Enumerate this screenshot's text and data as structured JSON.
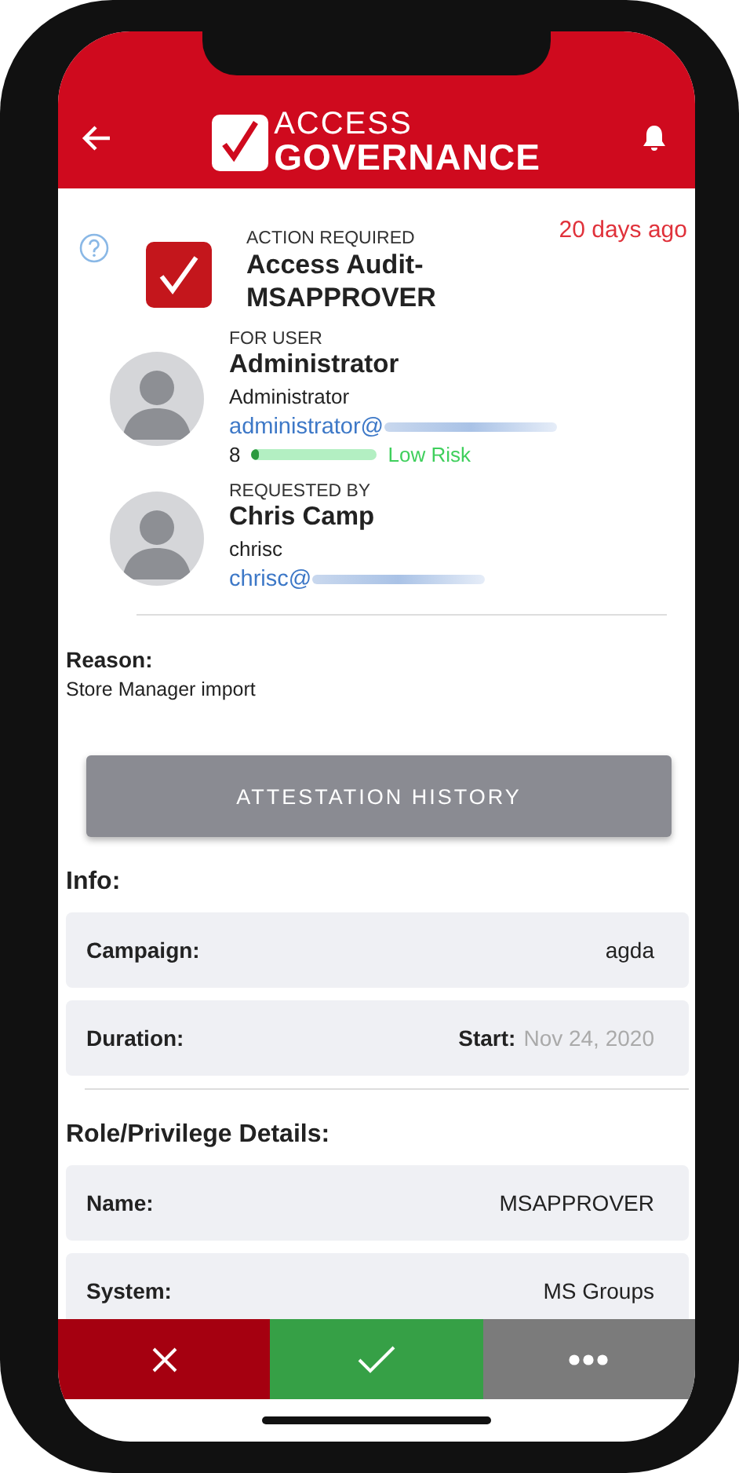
{
  "logo": {
    "line1": "ACCESS",
    "line2": "GOVERNANCE"
  },
  "request": {
    "label": "ACTION REQUIRED",
    "title_lines": [
      "Access Audit-",
      "MSAPPROVER"
    ],
    "age": "20 days ago"
  },
  "for_user": {
    "label": "FOR USER",
    "name": "Administrator",
    "username": "Administrator",
    "email": "administrator@",
    "risk": {
      "score": "8",
      "level": 0.06,
      "label": "Low Risk"
    }
  },
  "requested_by": {
    "label": "REQUESTED BY",
    "name": "Chris Camp",
    "username": "chrisc",
    "email": "chrisc@"
  },
  "reason": {
    "label": "Reason:",
    "text": "Store Manager import"
  },
  "history_button": "ATTESTATION HISTORY",
  "info": {
    "title": "Info:",
    "rows": [
      {
        "label": "Campaign:",
        "value": "agda"
      },
      {
        "label": "Duration:",
        "prefix": "Start:",
        "value": "Nov 24, 2020"
      }
    ]
  },
  "role_details": {
    "title": "Role/Privilege Details:",
    "rows": [
      {
        "label": "Name:",
        "value": "MSAPPROVER"
      },
      {
        "label": "System:",
        "value": "MS Groups"
      }
    ]
  },
  "actions": [
    {
      "kind": "reject"
    },
    {
      "kind": "approve"
    },
    {
      "kind": "more"
    }
  ]
}
